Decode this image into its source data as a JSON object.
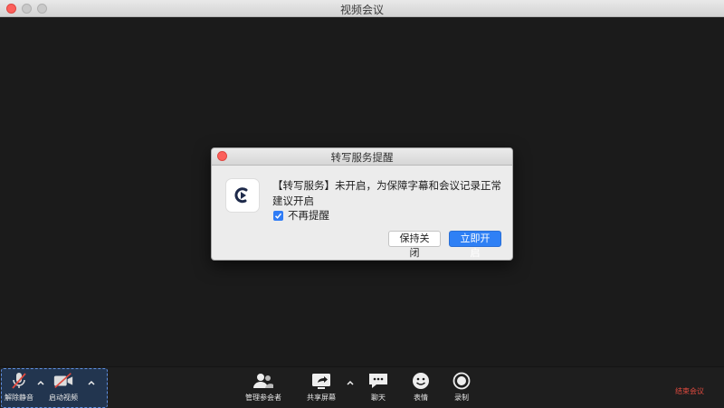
{
  "window": {
    "title": "视频会议"
  },
  "dialog": {
    "title": "转写服务提醒",
    "message": "【转写服务】未开启，为保障字幕和会议记录正常建议开启",
    "checkbox_label": "不再提醒",
    "checkbox_checked": true,
    "keep_closed_label": "保持关闭",
    "open_now_label": "立即开启"
  },
  "toolbar": {
    "unmute_label": "解除静音",
    "start_video_label": "启动视频",
    "manage_participants_label": "管理参会者",
    "share_screen_label": "共享屏幕",
    "chat_label": "聊天",
    "reactions_label": "表情",
    "record_label": "录制",
    "end_meeting_label": "结束会议"
  },
  "colors": {
    "accent": "#2f80f5",
    "end": "#e04a3f",
    "av_group_bg": "#22354f"
  },
  "icons": [
    "mic-muted-icon",
    "camera-off-icon",
    "participants-icon",
    "share-screen-icon",
    "chat-icon",
    "emoji-icon",
    "record-icon",
    "chevron-up-icon",
    "ear-play-icon",
    "checkmark-icon"
  ]
}
